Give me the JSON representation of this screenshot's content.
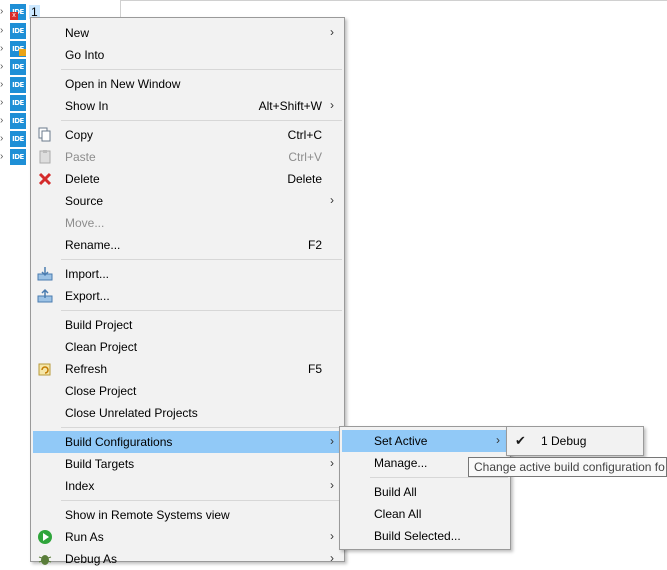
{
  "tree": {
    "rows": [
      {
        "label": "1"
      },
      {
        "label": ""
      },
      {
        "label": ""
      },
      {
        "label": ""
      },
      {
        "label": ""
      },
      {
        "label": ""
      },
      {
        "label": ""
      },
      {
        "label": ""
      },
      {
        "label": ""
      }
    ],
    "icon_text": "IDE"
  },
  "context_menu": {
    "new": "New",
    "go_into": "Go Into",
    "open_new_window": "Open in New Window",
    "show_in": "Show In",
    "show_in_shortcut": "Alt+Shift+W",
    "copy": "Copy",
    "copy_shortcut": "Ctrl+C",
    "paste": "Paste",
    "paste_shortcut": "Ctrl+V",
    "delete": "Delete",
    "delete_shortcut": "Delete",
    "source": "Source",
    "move": "Move...",
    "rename": "Rename...",
    "rename_shortcut": "F2",
    "import": "Import...",
    "export": "Export...",
    "build_project": "Build Project",
    "clean_project": "Clean Project",
    "refresh": "Refresh",
    "refresh_shortcut": "F5",
    "close_project": "Close Project",
    "close_unrelated": "Close Unrelated Projects",
    "build_configurations": "Build Configurations",
    "build_targets": "Build Targets",
    "index": "Index",
    "show_remote": "Show in Remote Systems view",
    "run_as": "Run As",
    "debug_as": "Debug As"
  },
  "build_config_menu": {
    "set_active": "Set Active",
    "manage": "Manage...",
    "build_all": "Build All",
    "clean_all": "Clean All",
    "build_selected": "Build Selected..."
  },
  "set_active_menu": {
    "debug": "1 Debug"
  },
  "tooltip": "Change active build configuration fo",
  "colors": {
    "highlight": "#91c9f7",
    "menu_bg": "#f2f2f2",
    "project_icon": "#1e8fd6"
  }
}
